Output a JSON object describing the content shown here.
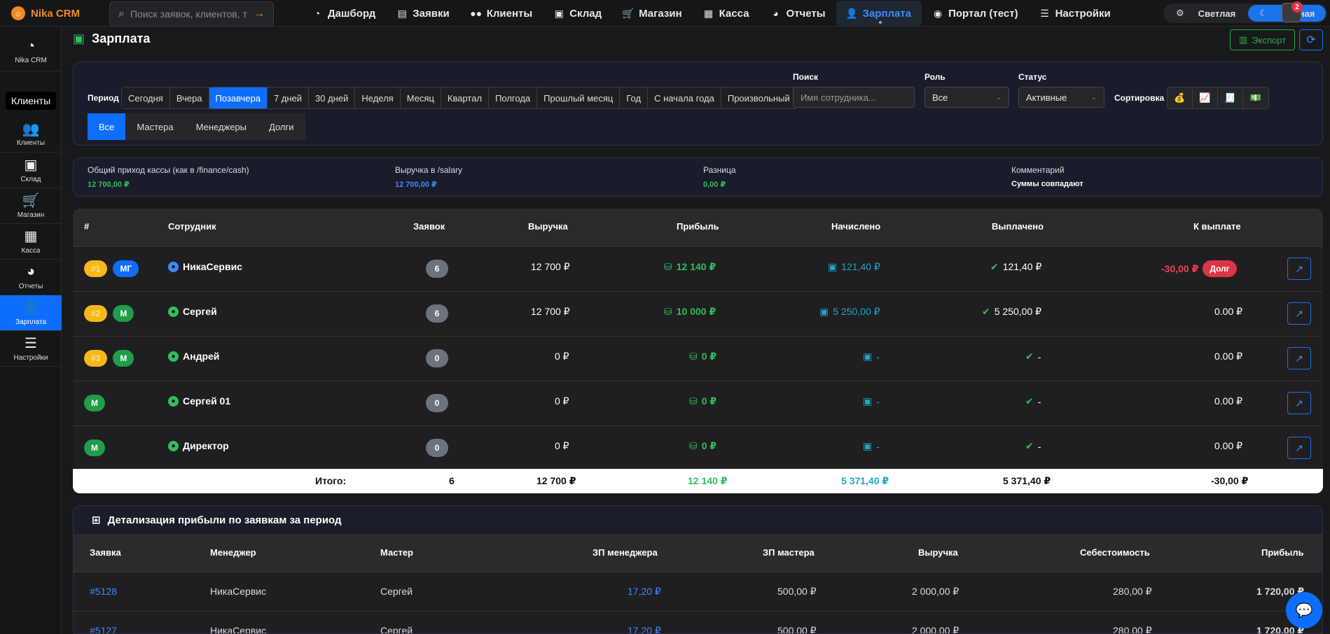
{
  "app": {
    "name": "Nika CRM"
  },
  "topbar": {
    "search_placeholder": "Поиск заявок, клиентов, т",
    "nav": [
      {
        "label": "Дашборд",
        "icon": "gauge-icon"
      },
      {
        "label": "Заявки",
        "icon": "document-icon"
      },
      {
        "label": "Клиенты",
        "icon": "users-icon"
      },
      {
        "label": "Склад",
        "icon": "boxes-icon"
      },
      {
        "label": "Магазин",
        "icon": "cart-icon"
      },
      {
        "label": "Касса",
        "icon": "cash-register-icon"
      },
      {
        "label": "Отчеты",
        "icon": "pie-chart-icon"
      },
      {
        "label": "Зарплата",
        "icon": "user-icon",
        "active": true
      },
      {
        "label": "Портал (тест)",
        "icon": "user-circle-icon"
      },
      {
        "label": "Настройки",
        "icon": "sliders-icon"
      }
    ],
    "theme_light": "Светлая",
    "theme_dark": "Тёмная",
    "notifications_count": "2"
  },
  "sidebar": {
    "items": [
      {
        "label": "Nika CRM"
      },
      {
        "label": "Клиенты"
      },
      {
        "label": "Склад"
      },
      {
        "label": "Магазин"
      },
      {
        "label": "Касса"
      },
      {
        "label": "Отчеты"
      },
      {
        "label": "Зарплата",
        "active": true
      },
      {
        "label": "Настройки"
      }
    ],
    "tooltip": "Клиенты"
  },
  "page": {
    "title": "Зарплата",
    "export_label": "Экспорт"
  },
  "filters": {
    "period_label": "Период",
    "periods": [
      "Сегодня",
      "Вчера",
      "Позавчера",
      "7 дней",
      "30 дней",
      "Неделя",
      "Месяц",
      "Квартал",
      "Полгода",
      "Прошлый месяц",
      "Год",
      "С начала года",
      "Произвольный"
    ],
    "active_period": "Позавчера",
    "groups": [
      "Все",
      "Мастера",
      "Менеджеры",
      "Долги"
    ],
    "search_label": "Поиск",
    "search_placeholder": "Имя сотрудника...",
    "role_label": "Роль",
    "role_value": "Все",
    "status_label": "Статус",
    "status_value": "Активные",
    "sort_label": "Сортировка"
  },
  "summary": {
    "cash_label": "Общий приход кассы (как в /finance/cash)",
    "cash_value": "12 700,00 ₽",
    "salary_label": "Выручка в /salary",
    "salary_value": "12 700,00 ₽",
    "diff_label": "Разница",
    "diff_value": "0,00 ₽",
    "comment_label": "Комментарий",
    "comment_value": "Суммы совпадают"
  },
  "table": {
    "headers": [
      "#",
      "Сотрудник",
      "Заявок",
      "Выручка",
      "Прибыль",
      "Начислено",
      "Выплачено",
      "К выплате"
    ],
    "rows": [
      {
        "rank": "#1",
        "role": "МГ",
        "name": "НикаСервис",
        "orders": "6",
        "revenue": "12 700 ₽",
        "profit": "12 140 ₽",
        "accrued": "121,40 ₽",
        "paid": "121,40 ₽",
        "due": "-30,00 ₽",
        "debt": "Долг"
      },
      {
        "rank": "#2",
        "role": "М",
        "name": "Сергей",
        "orders": "6",
        "revenue": "12 700 ₽",
        "profit": "10 000 ₽",
        "accrued": "5 250,00 ₽",
        "paid": "5 250,00 ₽",
        "due": "0.00 ₽"
      },
      {
        "rank": "#3",
        "role": "М",
        "name": "Андрей",
        "orders": "0",
        "revenue": "0 ₽",
        "profit": "0 ₽",
        "accrued": "-",
        "paid": "-",
        "due": "0.00 ₽"
      },
      {
        "rank": "",
        "role": "М",
        "name": "Сергей 01",
        "orders": "0",
        "revenue": "0 ₽",
        "profit": "0 ₽",
        "accrued": "-",
        "paid": "-",
        "due": "0.00 ₽"
      },
      {
        "rank": "",
        "role": "М",
        "name": "Директор",
        "orders": "0",
        "revenue": "0 ₽",
        "profit": "0 ₽",
        "accrued": "-",
        "paid": "-",
        "due": "0.00 ₽"
      }
    ],
    "footer": {
      "label": "Итого:",
      "orders": "6",
      "revenue": "12 700 ₽",
      "profit": "12 140 ₽",
      "accrued": "5 371,40 ₽",
      "paid": "5 371,40 ₽",
      "due": "-30,00 ₽"
    }
  },
  "detail": {
    "title": "Детализация прибыли по заявкам за период",
    "headers": [
      "Заявка",
      "Менеджер",
      "Мастер",
      "ЗП менеджера",
      "ЗП мастера",
      "Выручка",
      "Себестоимость",
      "Прибыль"
    ],
    "rows": [
      {
        "order": "#5128",
        "manager": "НикаСервис",
        "master": "Сергей",
        "mgr_pay": "17,20 ₽",
        "master_pay": "500,00 ₽",
        "revenue": "2 000,00 ₽",
        "cost": "280,00 ₽",
        "profit": "1 720,00 ₽"
      },
      {
        "order": "#5127",
        "manager": "НикаСервис",
        "master": "Сергей",
        "mgr_pay": "17,20 ₽",
        "master_pay": "500,00 ₽",
        "revenue": "2 000,00 ₽",
        "cost": "280,00 ₽",
        "profit": "1 720,00 ₽"
      }
    ]
  },
  "colors": {
    "accent": "#0d6efd",
    "brand": "#f08a24",
    "green": "#2fbf5b",
    "teal": "#1fa7c4",
    "red": "#f04150"
  }
}
